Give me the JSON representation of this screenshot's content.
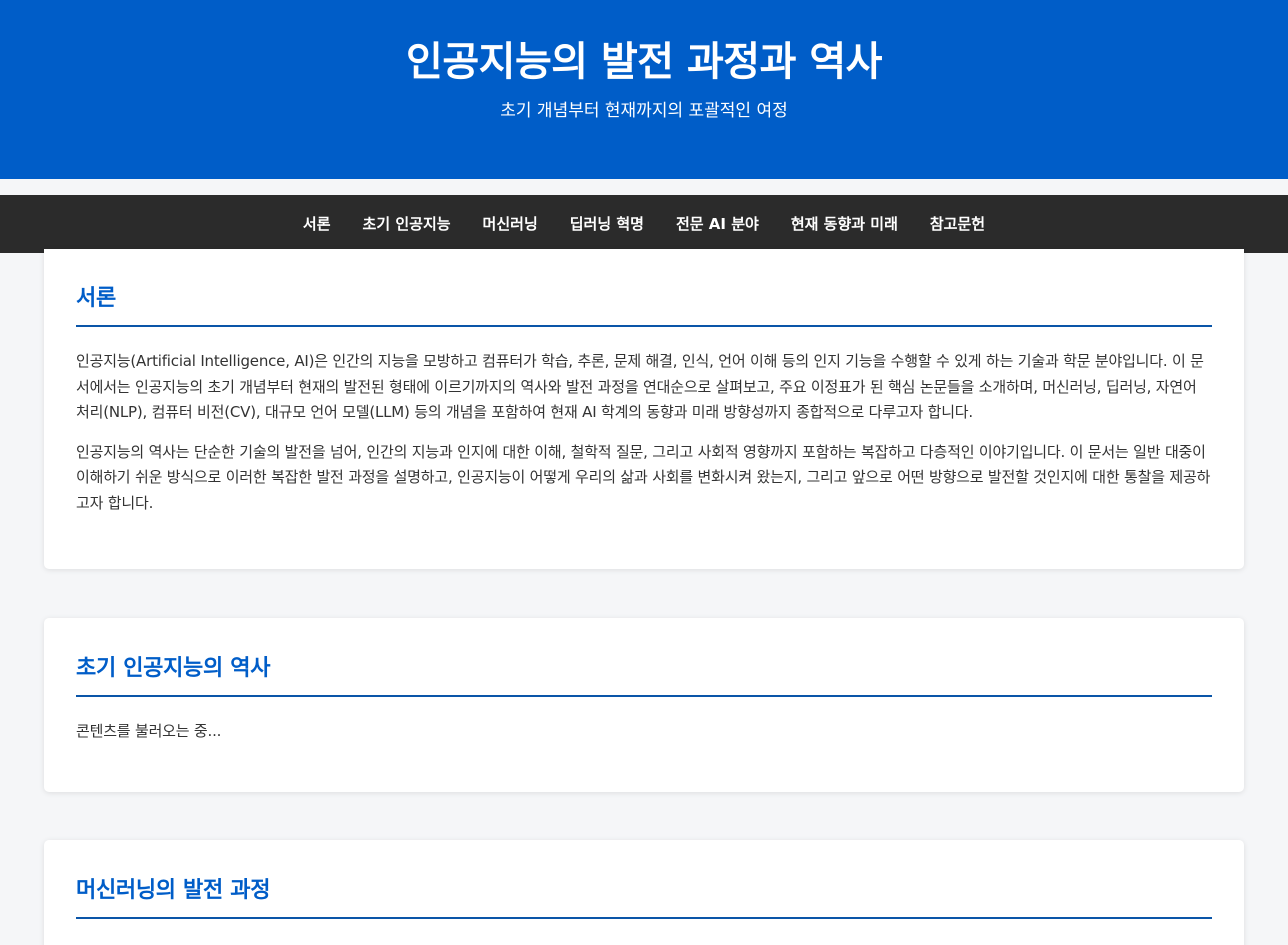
{
  "header": {
    "title": "인공지능의 발전 과정과 역사",
    "subtitle": "초기 개념부터 현재까지의 포괄적인 여정"
  },
  "nav": {
    "items": [
      "서론",
      "초기 인공지능",
      "머신러닝",
      "딥러닝 혁명",
      "전문 AI 분야",
      "현재 동향과 미래",
      "참고문헌"
    ]
  },
  "sections": [
    {
      "title": "서론",
      "paragraphs": [
        "인공지능(Artificial Intelligence, AI)은 인간의 지능을 모방하고 컴퓨터가 학습, 추론, 문제 해결, 인식, 언어 이해 등의 인지 기능을 수행할 수 있게 하는 기술과 학문 분야입니다. 이 문서에서는 인공지능의 초기 개념부터 현재의 발전된 형태에 이르기까지의 역사와 발전 과정을 연대순으로 살펴보고, 주요 이정표가 된 핵심 논문들을 소개하며, 머신러닝, 딥러닝, 자연어 처리(NLP), 컴퓨터 비전(CV), 대규모 언어 모델(LLM) 등의 개념을 포함하여 현재 AI 학계의 동향과 미래 방향성까지 종합적으로 다루고자 합니다.",
        "인공지능의 역사는 단순한 기술의 발전을 넘어, 인간의 지능과 인지에 대한 이해, 철학적 질문, 그리고 사회적 영향까지 포함하는 복잡하고 다층적인 이야기입니다. 이 문서는 일반 대중이 이해하기 쉬운 방식으로 이러한 복잡한 발전 과정을 설명하고, 인공지능이 어떻게 우리의 삶과 사회를 변화시켜 왔는지, 그리고 앞으로 어떤 방향으로 발전할 것인지에 대한 통찰을 제공하고자 합니다."
      ]
    },
    {
      "title": "초기 인공지능의 역사",
      "paragraphs": [
        "콘텐츠를 불러오는 중..."
      ]
    },
    {
      "title": "머신러닝의 발전 과정",
      "paragraphs": []
    }
  ],
  "colors": {
    "hero_bg": "#005dc8",
    "nav_bg": "#2b2b2b",
    "heading": "#005dc8",
    "page_bg": "#f5f6f8"
  }
}
